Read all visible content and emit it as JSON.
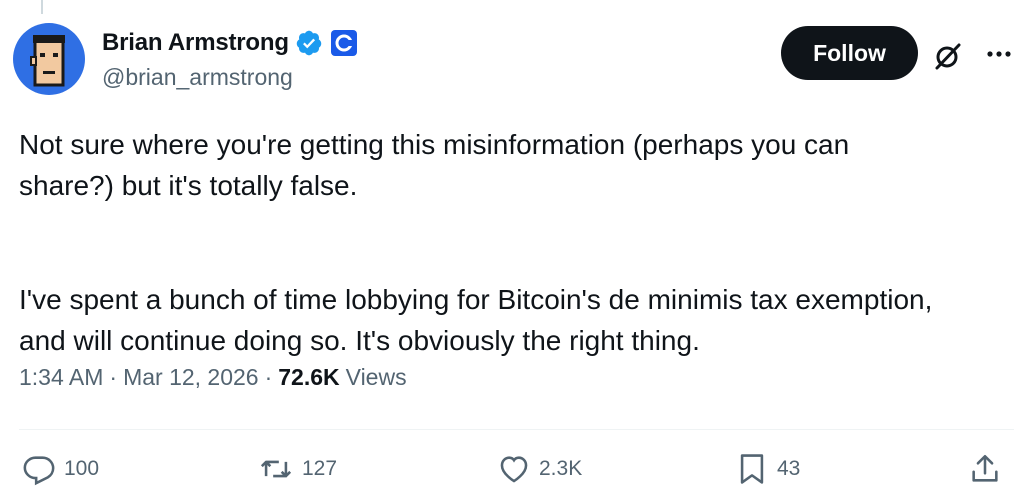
{
  "tweet": {
    "author": {
      "display_name": "Brian Armstrong",
      "handle": "@brian_armstrong",
      "verified_icon": "verified-badge-icon",
      "affiliation_icon": "coinbase-logo-icon"
    },
    "follow_label": "Follow",
    "text_paragraph_1": "Not sure where you're getting this misinformation (perhaps you can share?) but it's totally false.",
    "text_paragraph_2": "I've spent a bunch of time lobbying for Bitcoin's de minimis tax exemption, and will continue doing so. It's obviously the right thing.",
    "time": "1:34 AM",
    "date": "Mar 12, 2026",
    "views_count": "72.6K",
    "views_label": "Views",
    "separator": "·"
  },
  "actions": {
    "reply_count": "100",
    "repost_count": "127",
    "like_count": "2.3K",
    "bookmark_count": "43"
  },
  "colors": {
    "text_primary": "#0f1419",
    "text_secondary": "#536471",
    "verified_blue": "#1d9bf0",
    "coinbase_blue": "#1a5ae8",
    "avatar_bg": "#2f6fe4"
  }
}
